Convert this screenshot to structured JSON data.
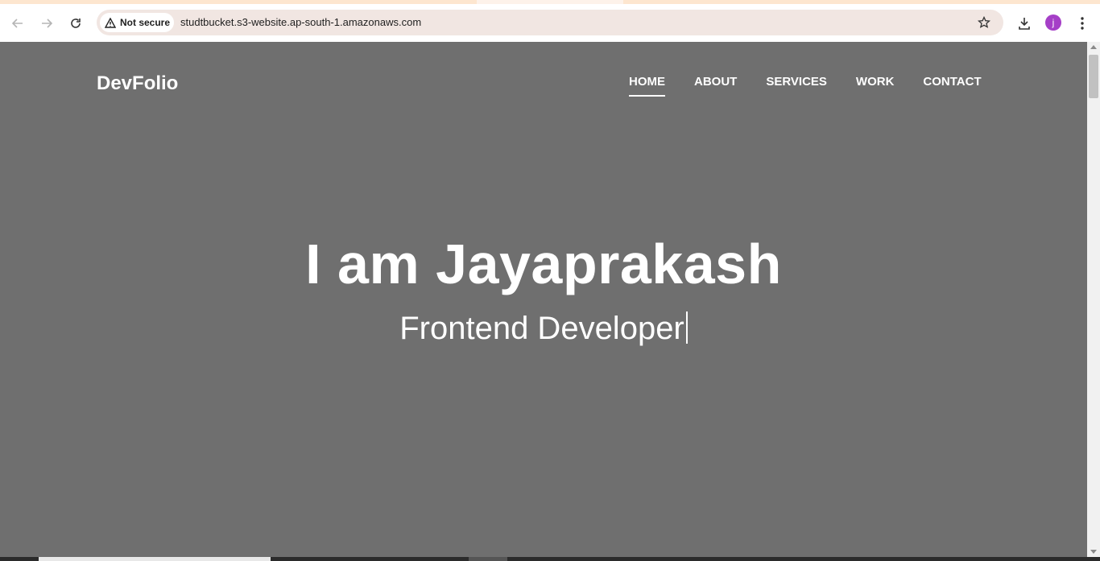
{
  "browser": {
    "security_label": "Not secure",
    "url": "studtbucket.s3-website.ap-south-1.amazonaws.com",
    "profile_initial": "j",
    "icons": [
      "back-icon",
      "forward-icon",
      "reload-icon",
      "warning-icon",
      "star-icon",
      "download-icon",
      "kebab-menu-icon"
    ],
    "colors": {
      "tabstrip": "#fde6cf",
      "omnibox": "#f1e6e2",
      "avatar": "#a53fc7"
    }
  },
  "site": {
    "logo": "DevFolio",
    "nav": [
      {
        "label": "HOME",
        "active": true
      },
      {
        "label": "ABOUT",
        "active": false
      },
      {
        "label": "SERVICES",
        "active": false
      },
      {
        "label": "WORK",
        "active": false
      },
      {
        "label": "CONTACT",
        "active": false
      }
    ],
    "hero": {
      "title": "I am Jayaprakash",
      "subtitle": "Frontend Developer"
    },
    "colors": {
      "background": "#6f6f6f",
      "text": "#ffffff"
    }
  }
}
